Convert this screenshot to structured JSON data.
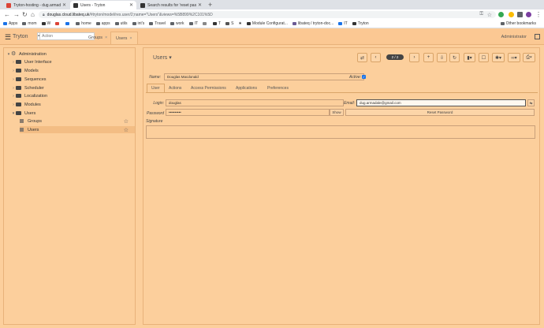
{
  "browser": {
    "tabs": [
      {
        "title": "Tryton-hosting - dug.armada...",
        "favicon_color": "#db4437"
      },
      {
        "title": "Users - Tryton",
        "favicon_color": "#333333"
      },
      {
        "title": "Search results for 'reset passw...",
        "favicon_color": "#333333"
      }
    ],
    "url_host": "douglas.cloud.libateq.uk",
    "url_path": "/#tryton/model/res.user/2;name=\"Users\"&views=%5B899%2C101%5D",
    "bookmarks": [
      "Apps",
      "mom",
      "W",
      "M",
      "",
      "home",
      "apps",
      "utils",
      "int's",
      "Travel",
      "work",
      "IT",
      "",
      "T",
      "S",
      "",
      "Module Configurat...",
      "libateq / tryton-doc...",
      "IT",
      "Tryton"
    ],
    "other_bookmarks": "Other bookmarks"
  },
  "app": {
    "title": "Tryton",
    "search_placeholder": "Action",
    "tabs": [
      {
        "label": "Groups"
      },
      {
        "label": "Users"
      }
    ],
    "user": "Administrator"
  },
  "sidebar": {
    "root": "Administration",
    "items": [
      {
        "label": "User Interface",
        "expanded": false
      },
      {
        "label": "Models",
        "expanded": false
      },
      {
        "label": "Sequences",
        "expanded": false
      },
      {
        "label": "Scheduler",
        "expanded": false
      },
      {
        "label": "Localization",
        "expanded": false
      },
      {
        "label": "Modules",
        "expanded": false
      },
      {
        "label": "Users",
        "expanded": true
      }
    ],
    "leaves": [
      {
        "label": "Groups"
      },
      {
        "label": "Users"
      }
    ]
  },
  "form": {
    "title": "Users",
    "counter": "2 / 2",
    "name_label": "Name:",
    "name_value": "Douglas Macdonald",
    "active_label": "Active:",
    "active_checked": true,
    "tabs": [
      "User",
      "Actions",
      "Access Permissions",
      "Applications",
      "Preferences"
    ],
    "login_label": "Login:",
    "login_value": "douglas",
    "email_label": "Email:",
    "email_value": "dug.armadale@gmail.com",
    "password_label": "Password",
    "password_value": "••••••••••",
    "show_label": "Show",
    "reset_label": "Reset Password",
    "signature_label": "Signature"
  }
}
